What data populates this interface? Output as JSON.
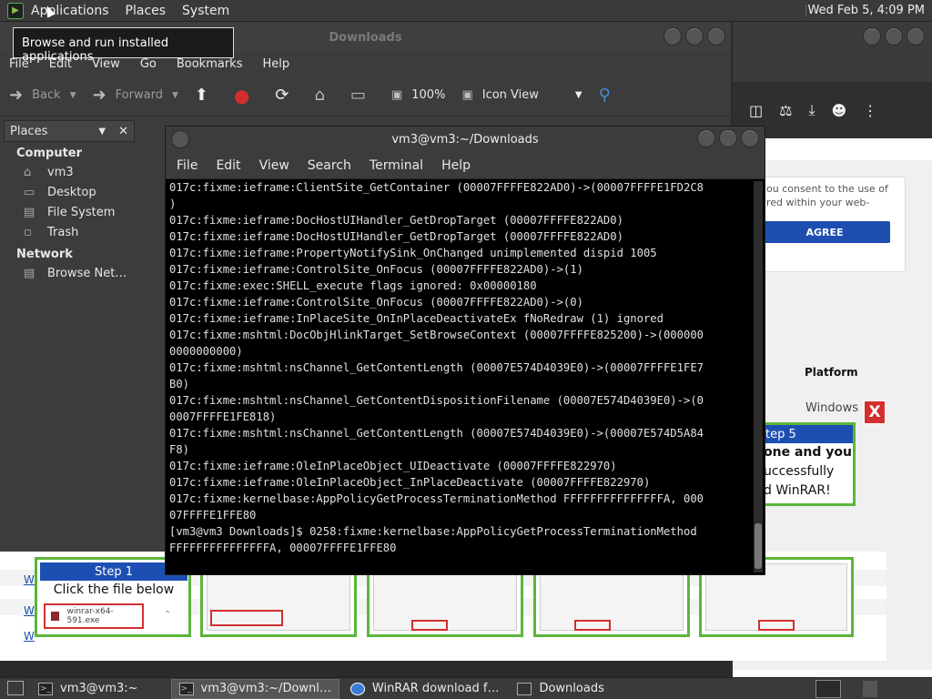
{
  "top_panel": {
    "menus": [
      "Applications",
      "Places",
      "System"
    ],
    "clock": "Wed Feb  5,  4:09 PM"
  },
  "tooltip": "Browse and run installed applications",
  "file_manager": {
    "title": "Downloads",
    "menus": [
      "File",
      "Edit",
      "View",
      "Go",
      "Bookmarks",
      "Help"
    ],
    "toolbar": {
      "back": "Back",
      "forward": "Forward",
      "zoom": "100%",
      "view_mode": "Icon View"
    },
    "sidebar": {
      "header": "Places",
      "groups": [
        {
          "label": "Computer",
          "items": [
            "vm3",
            "Desktop",
            "File System",
            "Trash"
          ]
        },
        {
          "label": "Network",
          "items": [
            "Browse Net…"
          ]
        }
      ]
    }
  },
  "terminal": {
    "title": "vm3@vm3:~/Downloads",
    "menus": [
      "File",
      "Edit",
      "View",
      "Search",
      "Terminal",
      "Help"
    ],
    "lines": [
      "017c:fixme:ieframe:ClientSite_GetContainer (00007FFFFE822AD0)->(00007FFFFE1FD2C8",
      ")",
      "017c:fixme:ieframe:DocHostUIHandler_GetDropTarget (00007FFFFE822AD0)",
      "017c:fixme:ieframe:DocHostUIHandler_GetDropTarget (00007FFFFE822AD0)",
      "017c:fixme:ieframe:PropertyNotifySink_OnChanged unimplemented dispid 1005",
      "017c:fixme:ieframe:ControlSite_OnFocus (00007FFFFE822AD0)->(1)",
      "017c:fixme:exec:SHELL_execute flags ignored: 0x00000180",
      "017c:fixme:ieframe:ControlSite_OnFocus (00007FFFFE822AD0)->(0)",
      "017c:fixme:ieframe:InPlaceSite_OnInPlaceDeactivateEx fNoRedraw (1) ignored",
      "017c:fixme:mshtml:DocObjHlinkTarget_SetBrowseContext (00007FFFFE825200)->(000000",
      "0000000000)",
      "017c:fixme:mshtml:nsChannel_GetContentLength (00007E574D4039E0)->(00007FFFFE1FE7",
      "B0)",
      "017c:fixme:mshtml:nsChannel_GetContentDispositionFilename (00007E574D4039E0)->(0",
      "0007FFFFE1FE818)",
      "017c:fixme:mshtml:nsChannel_GetContentLength (00007E574D4039E0)->(00007E574D5A84",
      "F8)",
      "017c:fixme:ieframe:OleInPlaceObject_UIDeactivate (00007FFFFE822970)",
      "017c:fixme:ieframe:OleInPlaceObject_InPlaceDeactivate (00007FFFFE822970)",
      "017c:fixme:kernelbase:AppPolicyGetProcessTerminationMethod FFFFFFFFFFFFFFFA, 000",
      "07FFFFE1FFE80",
      "[vm3@vm3 Downloads]$ 0258:fixme:kernelbase:AppPolicyGetProcessTerminationMethod",
      "FFFFFFFFFFFFFFFA, 00007FFFFE1FFE80"
    ]
  },
  "browser": {
    "consent_text": "ou consent to the use of\nred within your web-",
    "agree_button": "AGREE",
    "platform_header": "Platform",
    "windows_label": "Windows",
    "close_x": "X",
    "step5": {
      "header": "tep 5",
      "text_lines": [
        "one and you",
        "uccessfully",
        "d WinRAR!"
      ]
    },
    "step1": {
      "header": "Step 1",
      "subtitle": "Click the file below",
      "filename": "winrar-x64-591.exe"
    }
  },
  "taskbar": {
    "tasks": [
      "vm3@vm3:~",
      "vm3@vm3:~/Downl…",
      "WinRAR download f…",
      "Downloads"
    ]
  }
}
